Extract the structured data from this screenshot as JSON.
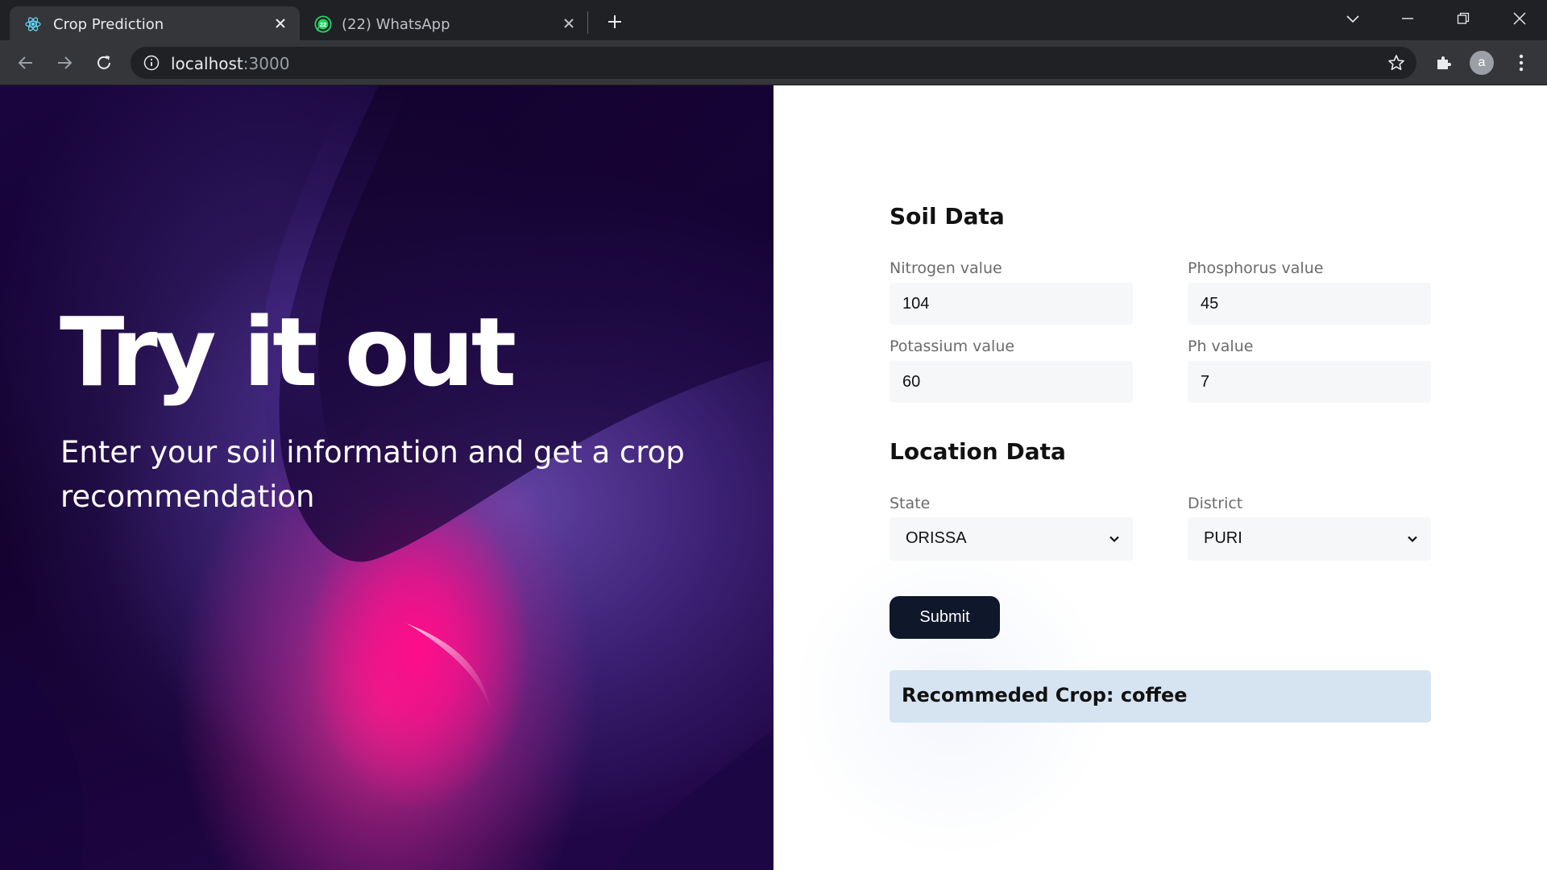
{
  "browser": {
    "tabs": [
      {
        "title": "Crop Prediction",
        "icon": "react-icon",
        "active": true
      },
      {
        "title": "(22) WhatsApp",
        "icon": "whatsapp-icon",
        "badge": "22",
        "active": false
      }
    ],
    "url_host": "localhost",
    "url_port": ":3000",
    "profile_initial": "a"
  },
  "hero": {
    "title": "Try it out",
    "subtitle": "Enter your soil information and get a crop recommendation"
  },
  "soil": {
    "heading": "Soil Data",
    "nitrogen_label": "Nitrogen value",
    "nitrogen_value": "104",
    "phosphorus_label": "Phosphorus value",
    "phosphorus_value": "45",
    "potassium_label": "Potassium value",
    "potassium_value": "60",
    "ph_label": "Ph value",
    "ph_value": "7"
  },
  "location": {
    "heading": "Location Data",
    "state_label": "State",
    "state_value": "ORISSA",
    "district_label": "District",
    "district_value": "PURI"
  },
  "form": {
    "submit_label": "Submit",
    "result_text": "Recommeded Crop: coffee"
  },
  "colors": {
    "chrome_dark": "#202124",
    "chrome_toolbar": "#35363a",
    "button": "#0f172a",
    "result_bg": "#d6e4f2",
    "hero_pink": "#ff0d8a",
    "hero_purple": "#1a0540"
  }
}
